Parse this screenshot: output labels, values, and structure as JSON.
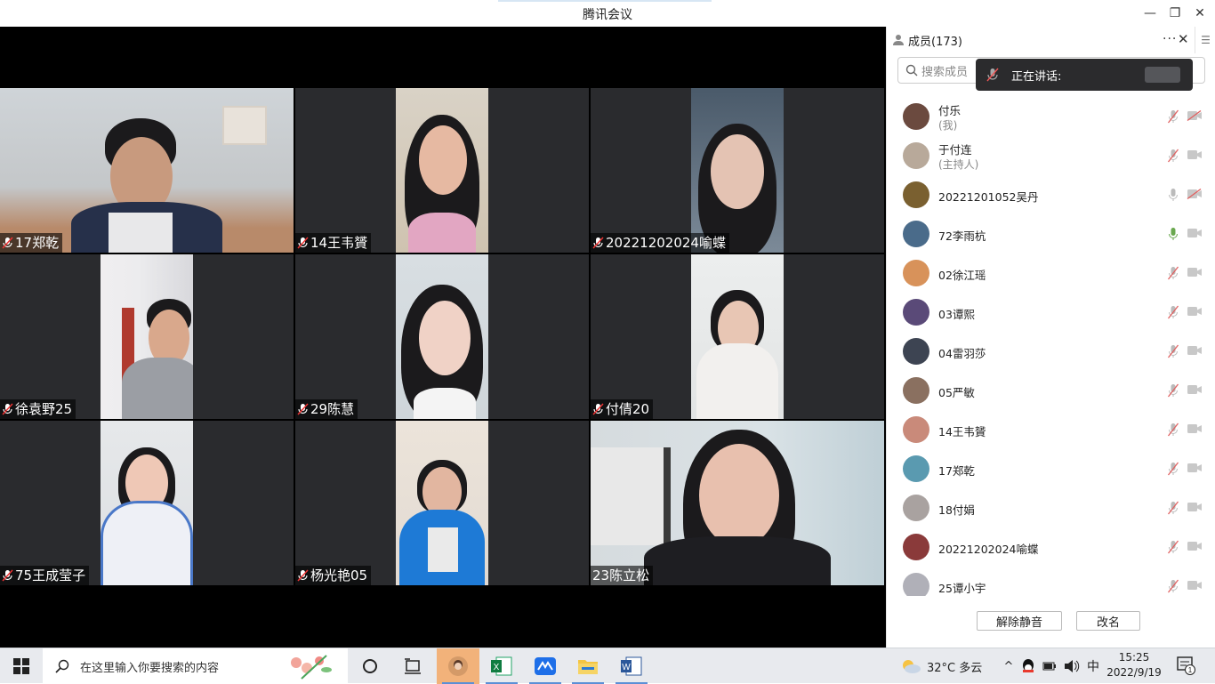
{
  "window": {
    "title": "腾讯会议"
  },
  "tiles": [
    {
      "name": "17郑乾",
      "mic": true
    },
    {
      "name": "14王韦贇",
      "mic": true
    },
    {
      "name": "20221202024喻蝶",
      "mic": true
    },
    {
      "name": "徐袁野25",
      "mic": true
    },
    {
      "name": "29陈慧",
      "mic": true
    },
    {
      "name": "付倩20",
      "mic": true
    },
    {
      "name": "75王成莹子",
      "mic": true
    },
    {
      "name": "杨光艳05",
      "mic": true
    },
    {
      "name": "23陈立松",
      "mic": false
    }
  ],
  "sidebar": {
    "header": "成员(173)",
    "more": "···",
    "search_placeholder": "搜索成员",
    "speaking_label": "正在讲话:",
    "members": [
      {
        "name": "付乐",
        "role": "(我)",
        "avatar_color": "#6b4a3f"
      },
      {
        "name": "于付连",
        "role": "(主持人)",
        "avatar_color": "#b8a99a"
      },
      {
        "name": "20221201052吴丹",
        "role": "",
        "avatar_color": "#7a6030"
      },
      {
        "name": "72李雨杭",
        "role": "",
        "avatar_color": "#4a6b8a"
      },
      {
        "name": "02徐江瑶",
        "role": "",
        "avatar_color": "#d8925a"
      },
      {
        "name": "03谭熙",
        "role": "",
        "avatar_color": "#5a4a78"
      },
      {
        "name": "04雷羽莎",
        "role": "",
        "avatar_color": "#3d4452"
      },
      {
        "name": "05严敏",
        "role": "",
        "avatar_color": "#8a7060"
      },
      {
        "name": "14王韦贇",
        "role": "",
        "avatar_color": "#c98a7a"
      },
      {
        "name": "17郑乾",
        "role": "",
        "avatar_color": "#5a9ab0"
      },
      {
        "name": "18付娟",
        "role": "",
        "avatar_color": "#a9a2a0"
      },
      {
        "name": "20221202024喻蝶",
        "role": "",
        "avatar_color": "#8a3a3a"
      },
      {
        "name": "25谭小宇",
        "role": "",
        "avatar_color": "#b0b0b8"
      }
    ],
    "unmute_label": "解除静音",
    "rename_label": "改名"
  },
  "taskbar": {
    "search_text": "在这里输入你要搜索的内容",
    "weather": "32°C  多云",
    "ime": "中",
    "time": "15:25",
    "date": "2022/9/19",
    "notif_count": "1"
  }
}
